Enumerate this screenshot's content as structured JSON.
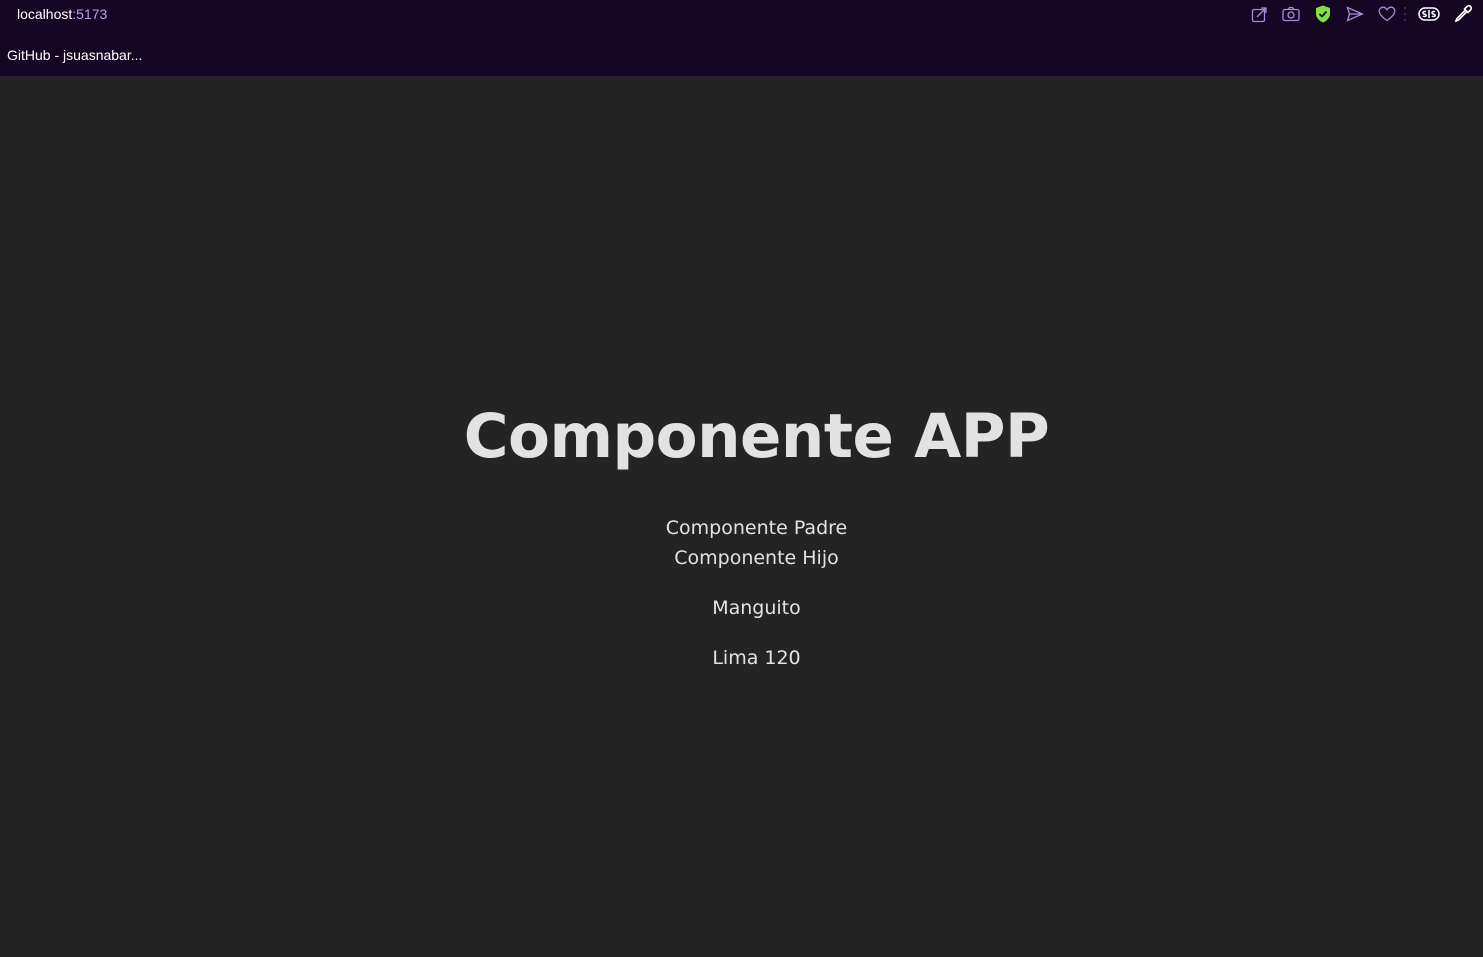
{
  "browser": {
    "address_host": "localhost",
    "address_port": ":5173",
    "bookmark_label": "GitHub - jsuasnabar...",
    "icons": [
      "share-icon",
      "camera-icon",
      "shield-check-icon",
      "send-icon",
      "heart-icon",
      "extension-icon",
      "eyedropper-icon"
    ],
    "accent_green": "#7ee33a",
    "accent_purple": "#b9a3e8"
  },
  "app": {
    "title": "Componente APP",
    "parent_label": "Componente Padre",
    "child_label": "Componente Hijo",
    "name": "Manguito",
    "address": "Lima 120"
  }
}
